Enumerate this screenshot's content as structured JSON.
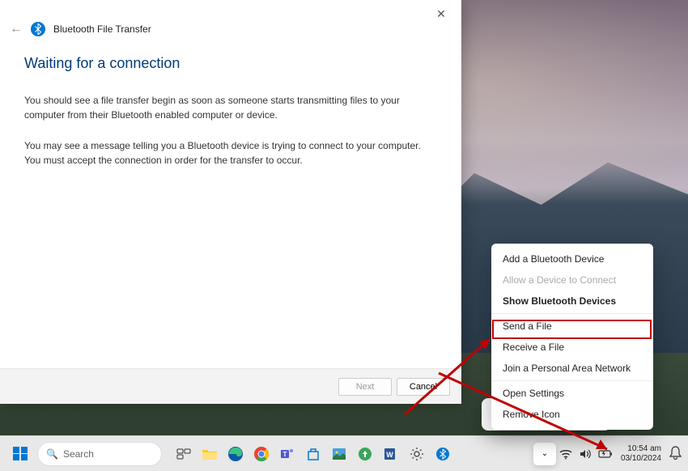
{
  "dialog": {
    "title": "Bluetooth File Transfer",
    "heading": "Waiting for a connection",
    "para1": "You should see a file transfer begin as soon as someone starts transmitting files to your computer from their Bluetooth enabled computer or device.",
    "para2": "You may see a message telling you a Bluetooth device is trying to connect to your computer. You must accept the connection in order for the transfer to occur.",
    "next": "Next",
    "cancel": "Cancel"
  },
  "menu": {
    "items": [
      {
        "label": "Add a Bluetooth Device",
        "type": "normal"
      },
      {
        "label": "Allow a Device to Connect",
        "type": "disabled"
      },
      {
        "label": "Show Bluetooth Devices",
        "type": "bold"
      },
      {
        "label": "Send a File",
        "type": "normal"
      },
      {
        "label": "Receive a File",
        "type": "normal"
      },
      {
        "label": "Join a Personal Area Network",
        "type": "normal"
      },
      {
        "label": "Open Settings",
        "type": "normal"
      },
      {
        "label": "Remove Icon",
        "type": "normal"
      }
    ]
  },
  "taskbar": {
    "search": "Search"
  },
  "clock": {
    "time": "10:54 am",
    "date": "03/10/2024"
  },
  "colors": {
    "accent": "#0078d4",
    "highlight": "#c00000"
  }
}
